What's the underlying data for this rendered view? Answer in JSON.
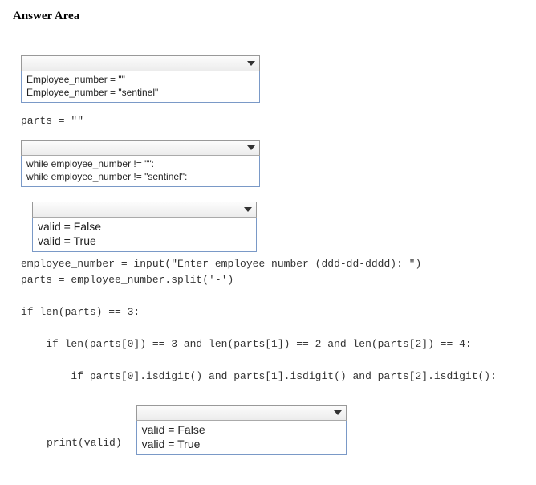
{
  "title": "Answer Area",
  "dropdown1": {
    "opt1": "Employee_number = \"\"",
    "opt2": "Employee_number = \"sentinel\""
  },
  "code1": "parts = \"\"",
  "dropdown2": {
    "opt1": "while employee_number != \"\":",
    "opt2": "while employee_number != \"sentinel\":"
  },
  "dropdown3": {
    "opt1": "valid = False",
    "opt2": "valid = True"
  },
  "code2": "employee_number = input(\"Enter employee number (ddd-dd-dddd): \")",
  "code3": "parts = employee_number.split('-')",
  "code4": "if len(parts) == 3:",
  "code5": "    if len(parts[0]) == 3 and len(parts[1]) == 2 and len(parts[2]) == 4:",
  "code6": "        if parts[0].isdigit() and parts[1].isdigit() and parts[2].isdigit():",
  "dropdown4": {
    "opt1": "valid = False",
    "opt2": "valid = True"
  },
  "code7": "print(valid)"
}
